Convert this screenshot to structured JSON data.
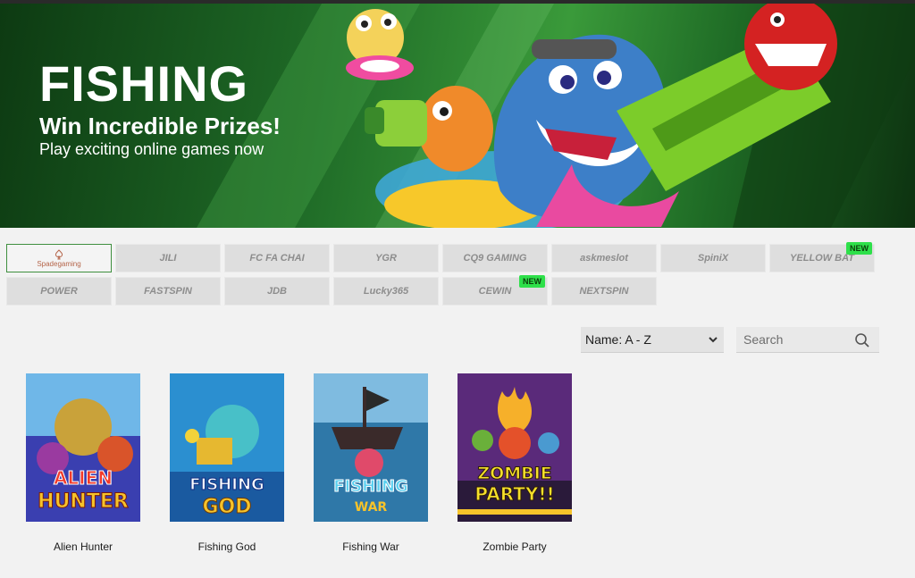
{
  "banner": {
    "title": "FISHING",
    "subtitle": "Win Incredible Prizes!",
    "tagline": "Play exciting online games now"
  },
  "providers": [
    {
      "label": "Spadegaming",
      "active": true
    },
    {
      "label": "JILI"
    },
    {
      "label": "FC FA CHAI"
    },
    {
      "label": "YGR"
    },
    {
      "label": "CQ9 GAMING"
    },
    {
      "label": "askmeslot"
    },
    {
      "label": "SpiniX"
    },
    {
      "label": "YELLOW BAT",
      "badge": "NEW"
    },
    {
      "label": "POWER"
    },
    {
      "label": "FASTSPIN"
    },
    {
      "label": "JDB"
    },
    {
      "label": "Lucky365"
    },
    {
      "label": "CEWIN",
      "badge": "NEW"
    },
    {
      "label": "NEXTSPIN"
    }
  ],
  "sort": {
    "selected": "Name: A - Z"
  },
  "search": {
    "placeholder": "Search"
  },
  "games": [
    {
      "name": "Alien Hunter",
      "thumb_line1": "ALIEN",
      "thumb_line2": "HUNTER"
    },
    {
      "name": "Fishing God",
      "thumb_line1": "FISHING",
      "thumb_line2": "GOD"
    },
    {
      "name": "Fishing War",
      "thumb_line1": "FISHING",
      "thumb_line2": "WAR"
    },
    {
      "name": "Zombie Party",
      "thumb_line1": "ZOMBIE",
      "thumb_line2": "PARTY!!"
    }
  ],
  "colors": {
    "accent_green": "#2ee04a",
    "banner_green": "#1f6b27",
    "active_border": "#3f8f3f"
  }
}
